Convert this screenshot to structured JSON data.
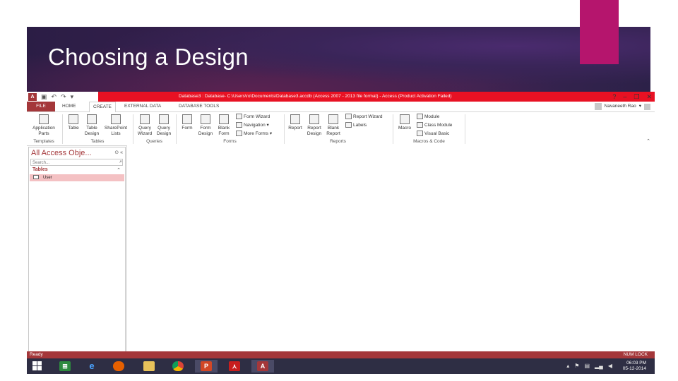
{
  "slide": {
    "title": "Choosing a Design"
  },
  "app": {
    "title_text": "Database3 : Database- C:\\Users\\ro\\Documents\\Database3.accdb (Access 2007 - 2013 file format) - Access (Product Activation Failed)",
    "window_controls": {
      "help": "?",
      "minimize": "–",
      "restore": "❐",
      "close": "✕"
    },
    "qat": {
      "logo": "A",
      "save": "▣",
      "undo": "↶",
      "redo": "↷",
      "customize": "▾"
    },
    "tabs": [
      {
        "label": "FILE"
      },
      {
        "label": "HOME"
      },
      {
        "label": "CREATE"
      },
      {
        "label": "EXTERNAL DATA"
      },
      {
        "label": "DATABASE TOOLS"
      }
    ],
    "user": {
      "name": "Navaneeth Rao",
      "caret": "▾"
    },
    "ribbon": {
      "templates": {
        "label": "Templates",
        "buttons": [
          {
            "label": "Application",
            "label2": "Parts"
          }
        ]
      },
      "tables": {
        "label": "Tables",
        "buttons": [
          {
            "label": "Table",
            "label2": ""
          },
          {
            "label": "Table",
            "label2": "Design"
          },
          {
            "label": "SharePoint",
            "label2": "Lists"
          }
        ]
      },
      "queries": {
        "label": "Queries",
        "buttons": [
          {
            "label": "Query",
            "label2": "Wizard"
          },
          {
            "label": "Query",
            "label2": "Design"
          }
        ]
      },
      "forms": {
        "label": "Forms",
        "buttons": [
          {
            "label": "Form",
            "label2": ""
          },
          {
            "label": "Form",
            "label2": "Design"
          },
          {
            "label": "Blank",
            "label2": "Form"
          }
        ],
        "small": [
          {
            "label": "Form Wizard"
          },
          {
            "label": "Navigation"
          },
          {
            "label": "More Forms"
          }
        ]
      },
      "reports": {
        "label": "Reports",
        "buttons": [
          {
            "label": "Report",
            "label2": ""
          },
          {
            "label": "Report",
            "label2": "Design"
          },
          {
            "label": "Blank",
            "label2": "Report"
          }
        ],
        "small": [
          {
            "label": "Report Wizard"
          },
          {
            "label": "Labels"
          }
        ]
      },
      "macros": {
        "label": "Macros & Code",
        "buttons": [
          {
            "label": "Macro",
            "label2": ""
          }
        ],
        "small": [
          {
            "label": "Module"
          },
          {
            "label": "Class Module"
          },
          {
            "label": "Visual Basic"
          }
        ]
      }
    },
    "nav_pane": {
      "title": "All Access Obje...",
      "search_placeholder": "Search...",
      "group": "Tables",
      "items": [
        {
          "label": "User"
        }
      ]
    },
    "status": {
      "left": "Ready",
      "right": "NUM LOCK"
    },
    "taskbar": {
      "clock_time": "06:03 PM",
      "clock_date": "05-12-2014"
    },
    "colors": {
      "access_red": "#a4373a",
      "title_red": "#e81123",
      "accent_magenta": "#b5156d"
    }
  }
}
